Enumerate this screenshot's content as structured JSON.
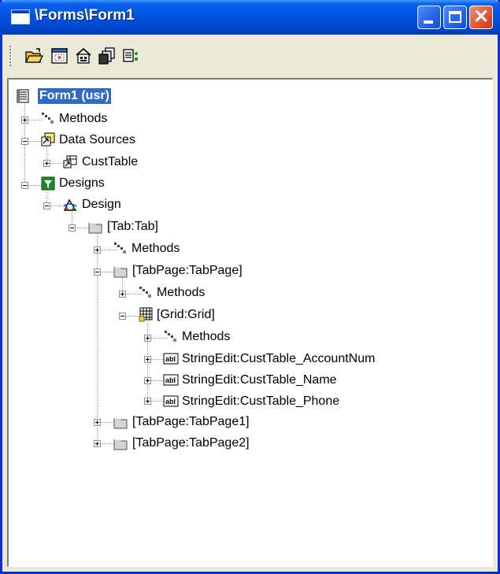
{
  "window": {
    "title": "\\Forms\\Form1"
  },
  "colors": {
    "title_bar": "#0055e5",
    "selection": "#316ac5",
    "close_button": "#e2583a"
  },
  "toolbar": {
    "icons": [
      "open-folder-icon",
      "form-layout-icon",
      "properties-icon",
      "copy-objects-icon",
      "node-list-icon"
    ]
  },
  "tree": {
    "root": {
      "label": "Form1 (usr)",
      "selected": true
    },
    "methods": "Methods",
    "data_sources": "Data Sources",
    "cust_table": "CustTable",
    "designs": "Designs",
    "design": "Design",
    "tab": "[Tab:Tab]",
    "tab_methods": "Methods",
    "tab_page": "[TabPage:TabPage]",
    "tab_page_methods": "Methods",
    "grid": "[Grid:Grid]",
    "grid_methods": "Methods",
    "field_account": "StringEdit:CustTable_AccountNum",
    "field_name": "StringEdit:CustTable_Name",
    "field_phone": "StringEdit:CustTable_Phone",
    "tab_page_1": "[TabPage:TabPage1]",
    "tab_page_2": "[TabPage:TabPage2]"
  }
}
